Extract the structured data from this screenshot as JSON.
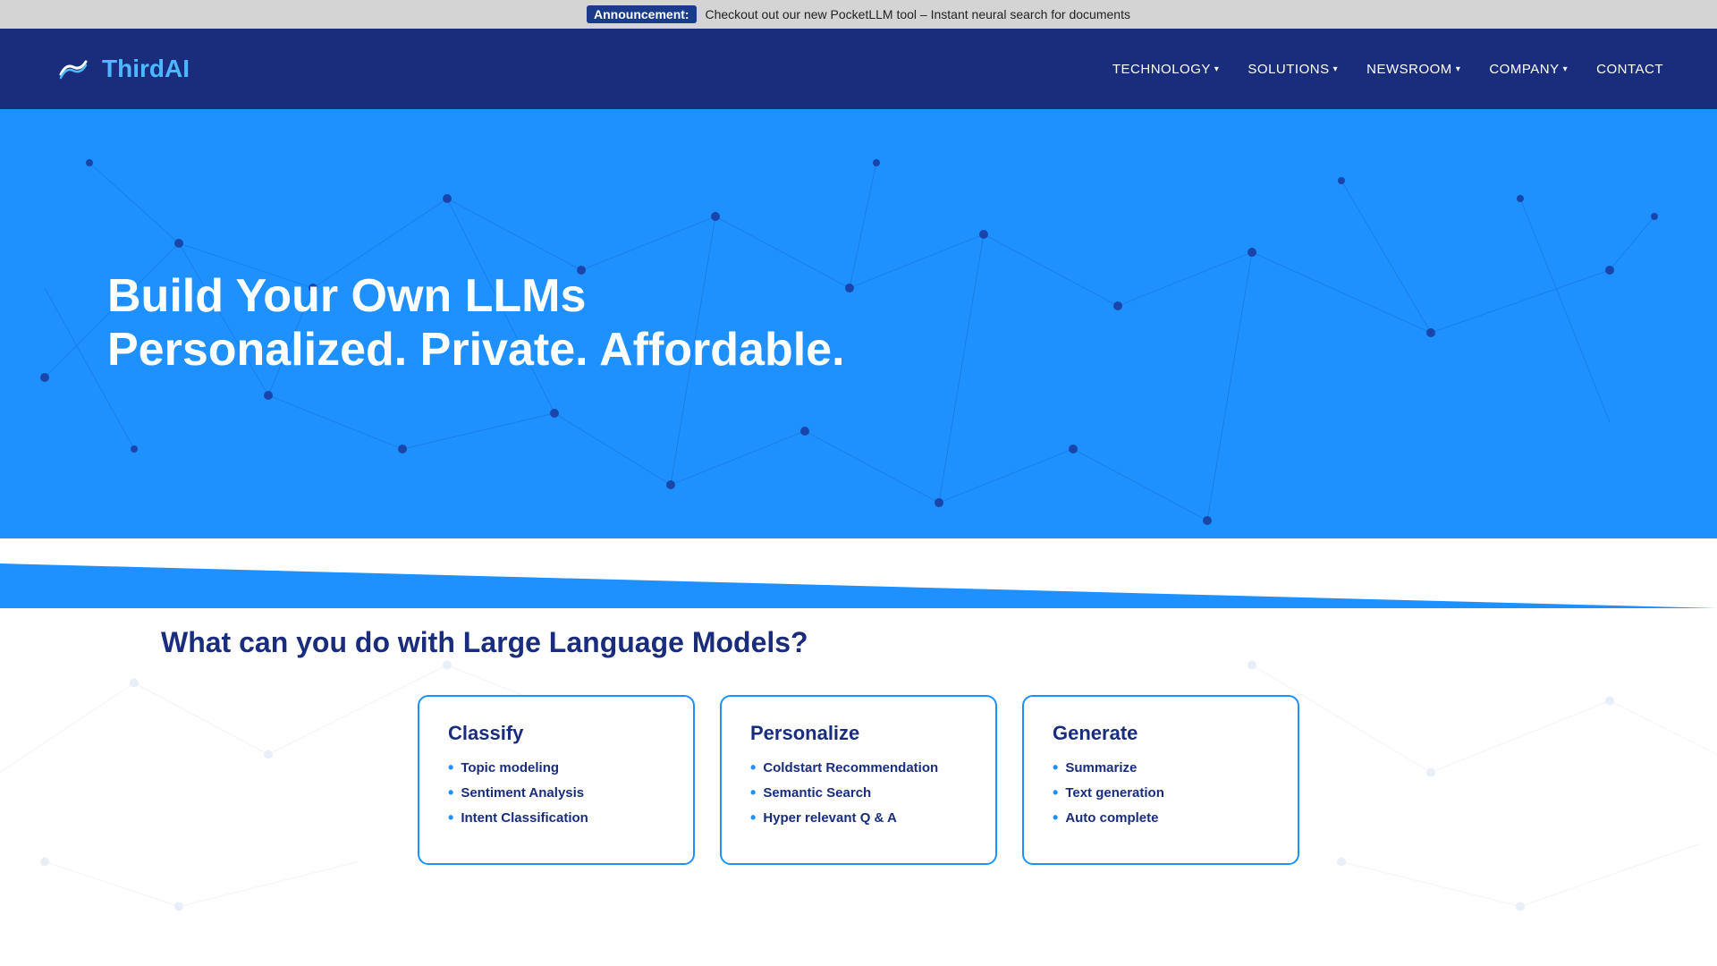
{
  "announcement": {
    "label": "Announcement:",
    "text": "Checkout out our new PocketLLM tool – Instant neural search for documents"
  },
  "nav": {
    "logo_text_plain": "Third",
    "logo_text_accent": "AI",
    "links": [
      {
        "label": "TECHNOLOGY",
        "has_dropdown": true
      },
      {
        "label": "SOLUTIONS",
        "has_dropdown": true
      },
      {
        "label": "NEWSROOM",
        "has_dropdown": true
      },
      {
        "label": "COMPANY",
        "has_dropdown": true
      },
      {
        "label": "CONTACT",
        "has_dropdown": false
      }
    ]
  },
  "hero": {
    "title_line1": "Build Your Own LLMs",
    "title_line2": "Personalized. Private. Affordable."
  },
  "cards_section": {
    "title": "What can you do with Large Language Models?",
    "cards": [
      {
        "title": "Classify",
        "items": [
          "Topic modeling",
          "Sentiment Analysis",
          "Intent Classification"
        ]
      },
      {
        "title": "Personalize",
        "items": [
          "Coldstart Recommendation",
          "Semantic Search",
          "Hyper relevant Q & A"
        ]
      },
      {
        "title": "Generate",
        "items": [
          "Summarize",
          "Text generation",
          "Auto complete"
        ]
      }
    ]
  }
}
